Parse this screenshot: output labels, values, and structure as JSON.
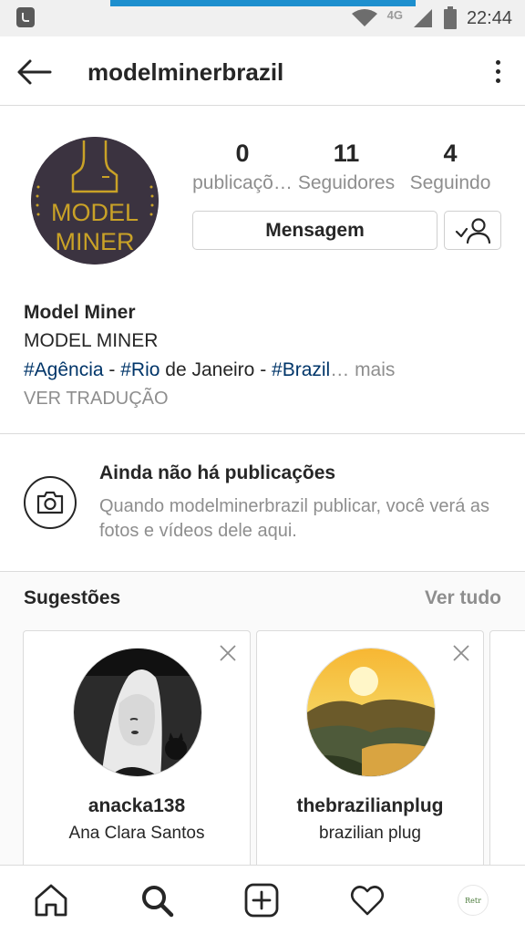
{
  "status_bar": {
    "network": "4G",
    "time": "22:44"
  },
  "header": {
    "username": "modelminerbrazil"
  },
  "profile": {
    "avatar_text": [
      "MODEL",
      "MINER"
    ],
    "stats": [
      {
        "value": "0",
        "label": "publicaçõ…"
      },
      {
        "value": "11",
        "label": "Seguidores"
      },
      {
        "value": "4",
        "label": "Seguindo"
      }
    ],
    "message_button": "Mensagem",
    "bio": {
      "name": "Model Miner",
      "line1": "MODEL MINER",
      "tag1": "#Agência",
      "sep1": " - ",
      "tag2": "#Rio",
      "text1": " de Janeiro - ",
      "tag3": "#Brazil",
      "more": "… mais",
      "translate": "VER TRADUÇÃO"
    }
  },
  "empty_posts": {
    "title": "Ainda não há publicações",
    "description": "Quando modelminerbrazil publicar, você verá as fotos e vídeos dele aqui."
  },
  "suggestions": {
    "title": "Sugestões",
    "see_all": "Ver tudo",
    "cards": [
      {
        "username": "anacka138",
        "full_name": "Ana Clara Santos"
      },
      {
        "username": "thebrazilianplug",
        "full_name": "brazilian plug"
      }
    ]
  },
  "bottom_nav": {
    "profile_thumb_text": "Retr"
  },
  "colors": {
    "link": "#003569",
    "muted": "#8e8e8e",
    "status_accent": "#1d8fce",
    "avatar_gold": "#c9a227"
  }
}
